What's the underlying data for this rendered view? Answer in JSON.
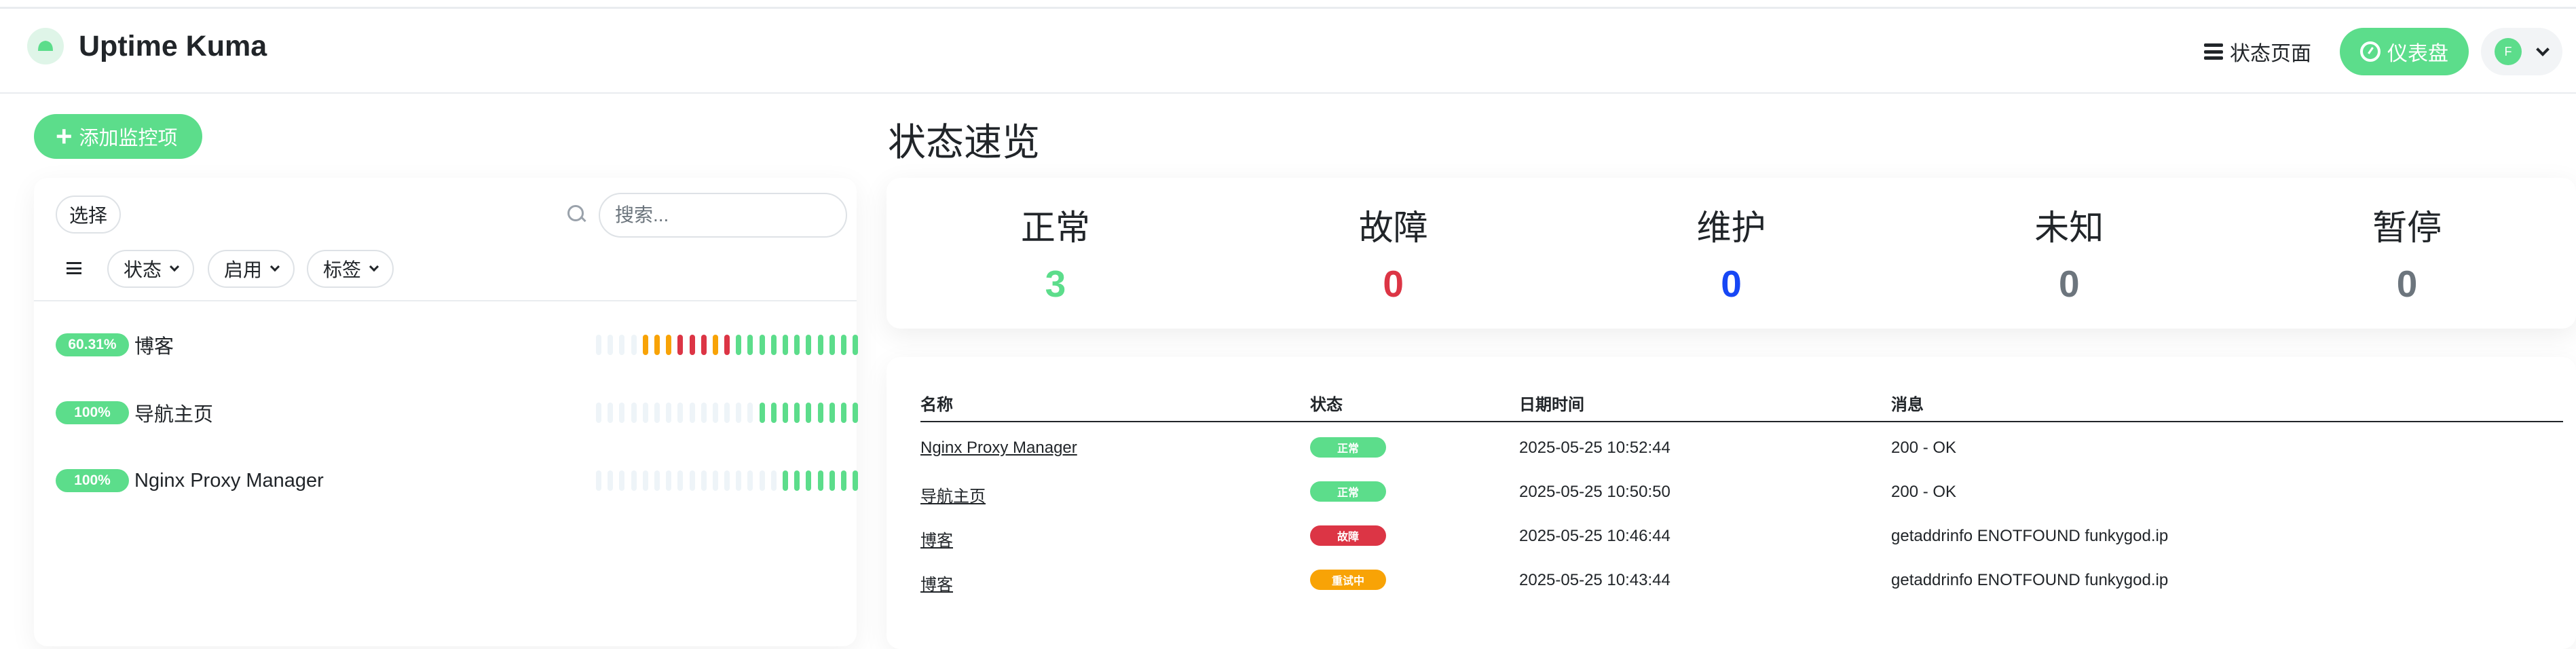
{
  "app": {
    "title": "Uptime Kuma",
    "brand_color": "#5cdd8b"
  },
  "nav": {
    "status_page": "状态页面",
    "dashboard": "仪表盘",
    "avatar_initial": "F"
  },
  "add_monitor": "添加监控项",
  "list": {
    "select": "选择",
    "search_placeholder": "搜索...",
    "filters": [
      "状态",
      "启用",
      "标签"
    ],
    "monitors": [
      {
        "uptime": "60.31%",
        "name": "博客",
        "beats": [
          "empty",
          "empty",
          "empty",
          "empty",
          "pending",
          "pending",
          "pending",
          "down",
          "down",
          "down",
          "pending",
          "down",
          "up",
          "up",
          "up",
          "up",
          "up",
          "up",
          "up",
          "up",
          "up",
          "up",
          "up"
        ]
      },
      {
        "uptime": "100%",
        "name": "导航主页",
        "beats": [
          "empty",
          "empty",
          "empty",
          "empty",
          "empty",
          "empty",
          "empty",
          "empty",
          "empty",
          "empty",
          "empty",
          "empty",
          "empty",
          "empty",
          "up",
          "up",
          "up",
          "up",
          "up",
          "up",
          "up",
          "up",
          "up"
        ]
      },
      {
        "uptime": "100%",
        "name": "Nginx Proxy Manager",
        "beats": [
          "empty",
          "empty",
          "empty",
          "empty",
          "empty",
          "empty",
          "empty",
          "empty",
          "empty",
          "empty",
          "empty",
          "empty",
          "empty",
          "empty",
          "empty",
          "empty",
          "up",
          "up",
          "up",
          "up",
          "up",
          "up",
          "up"
        ]
      }
    ]
  },
  "overview": {
    "title": "状态速览",
    "stats": [
      {
        "label": "正常",
        "value": "3",
        "color": "#5cdd8b"
      },
      {
        "label": "故障",
        "value": "0",
        "color": "#dc3545"
      },
      {
        "label": "维护",
        "value": "0",
        "color": "#1747f5"
      },
      {
        "label": "未知",
        "value": "0",
        "color": "#6c757d"
      },
      {
        "label": "暂停",
        "value": "0",
        "color": "#6c757d"
      }
    ]
  },
  "events": {
    "headers": {
      "name": "名称",
      "status": "状态",
      "datetime": "日期时间",
      "message": "消息"
    },
    "rows": [
      {
        "name": "Nginx Proxy Manager",
        "status": "正常",
        "status_color": "#5cdd8b",
        "datetime": "2025-05-25 10:52:44",
        "message": "200 - OK"
      },
      {
        "name": "导航主页",
        "status": "正常",
        "status_color": "#5cdd8b",
        "datetime": "2025-05-25 10:50:50",
        "message": "200 - OK"
      },
      {
        "name": "博客",
        "status": "故障",
        "status_color": "#dc3545",
        "datetime": "2025-05-25 10:46:44",
        "message": "getaddrinfo ENOTFOUND funkygod.ip"
      },
      {
        "name": "博客",
        "status": "重试中",
        "status_color": "#f8a306",
        "datetime": "2025-05-25 10:43:44",
        "message": "getaddrinfo ENOTFOUND funkygod.ip"
      }
    ]
  },
  "beat_colors": {
    "up": "#5cdd8b",
    "down": "#dc3545",
    "pending": "#f8a306",
    "empty": "#eef4f8"
  }
}
